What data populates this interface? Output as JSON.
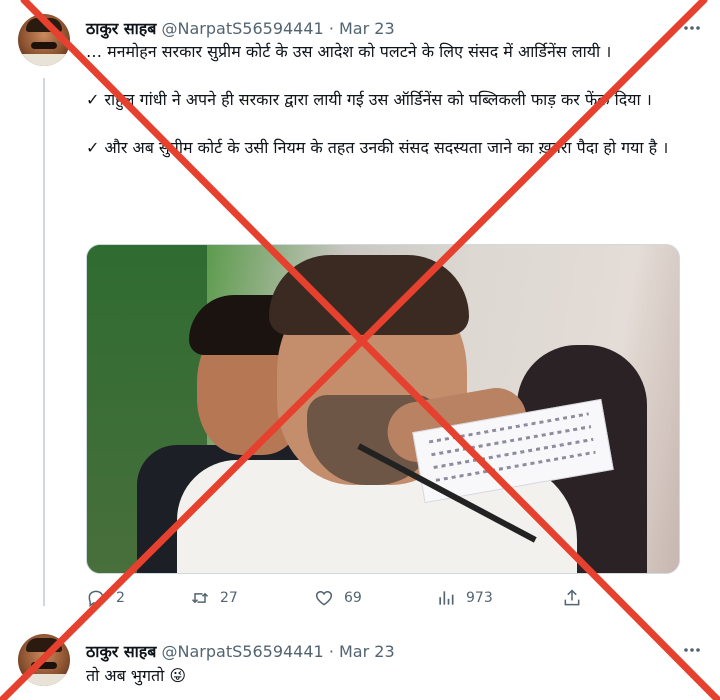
{
  "tweet1": {
    "display_name": "ठाकुर साहब",
    "handle": "@NarpatS56594441",
    "separator": "·",
    "date": "Mar 23",
    "more_icon": "more-horizontal-icon",
    "text": "… मनमोहन सरकार सुप्रीम कोर्ट के उस आदेश को पलटने के लिए संसद में आर्डिनेंस लायी ।\n\n✓ राहुल गांधी ने अपने ही सरकार द्वारा लायी गई उस ऑर्डिनेंस को पब्लिकली फाड़ कर फेंक दिया ।\n\n✓ और अब सुप्रीम कोर्ट के उसी नियम के तहत उनकी संसद सदस्यता जाने का ख़तरा पैदा हो गया है ।",
    "actions": {
      "reply_count": "2",
      "retweet_count": "27",
      "like_count": "69",
      "view_count": "973"
    }
  },
  "tweet2": {
    "display_name": "ठाकुर साहब",
    "handle": "@NarpatS56594441",
    "separator": "·",
    "date": "Mar 23",
    "text": "तो अब भुगतो 😜"
  },
  "overlay": {
    "cross_color": "#e5412e"
  }
}
